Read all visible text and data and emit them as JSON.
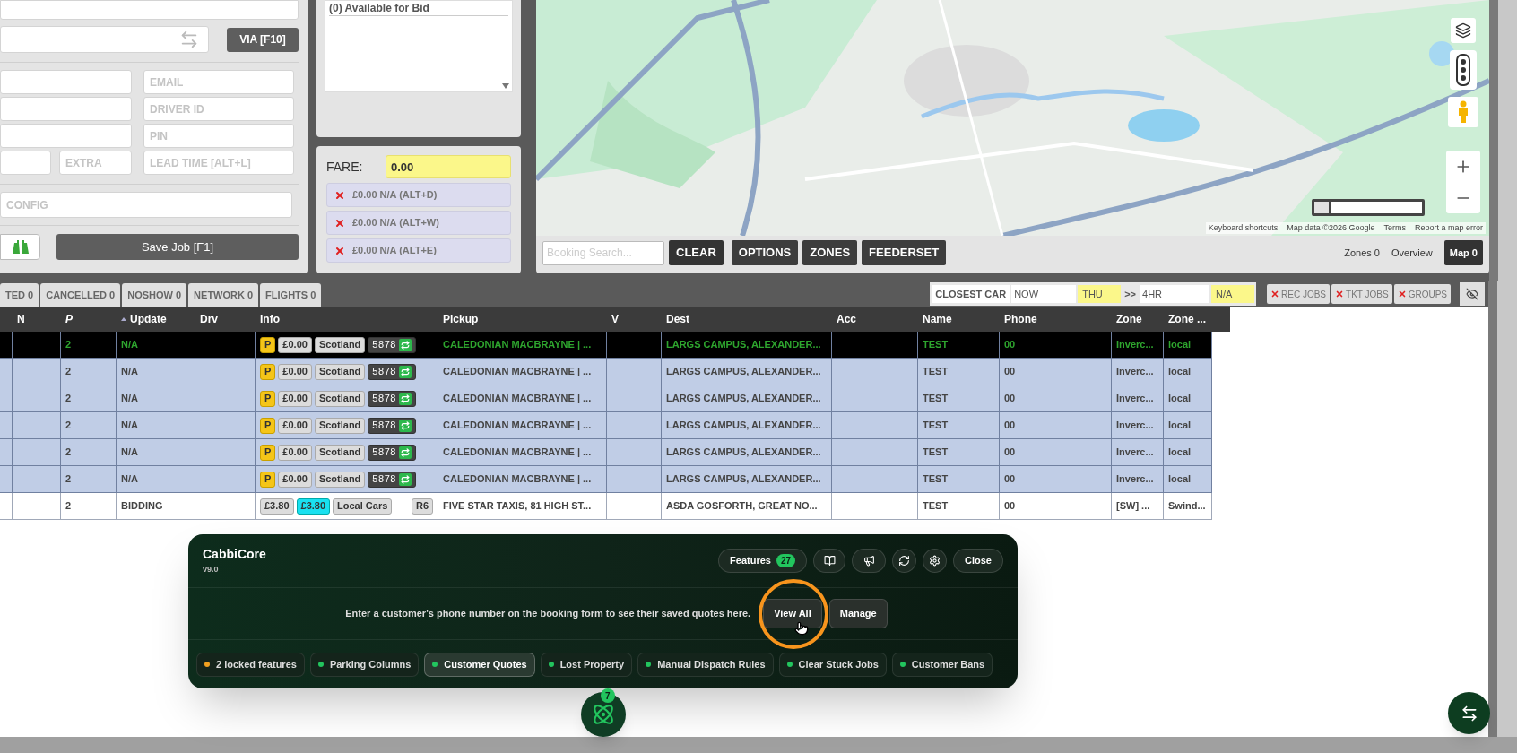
{
  "form": {
    "via_button": "VIA [F10]",
    "placeholders": [
      "EMAIL",
      "DRIVER ID",
      "PIN"
    ],
    "extra_placeholder": "EXTRA",
    "lead_time_placeholder": "LEAD TIME [ALT+L]",
    "config_placeholder": "CONFIG",
    "save_button": "Save Job [F1]"
  },
  "bid_list": {
    "items": [
      "(0) Available for Bid"
    ]
  },
  "fare": {
    "label": "FARE:",
    "value": "0.00",
    "extras": [
      "£0.00 N/A (ALT+D)",
      "£0.00 N/A (ALT+W)",
      "£0.00 N/A (ALT+E)"
    ]
  },
  "map": {
    "scale_slider": {
      "level": 0.15
    },
    "attribution": [
      "Keyboard shortcuts",
      "Map data ©2026 Google",
      "Terms",
      "Report a map error"
    ],
    "search": {
      "placeholder": "Booking Search..."
    },
    "buttons": [
      "CLEAR",
      "OPTIONS",
      "ZONES",
      "FEEDERSET"
    ],
    "status": [
      "Zones 0",
      "Overview"
    ],
    "map_button": "Map 0"
  },
  "tabs": [
    {
      "label": "TED 0"
    },
    {
      "label": "CANCELLED 0"
    },
    {
      "label": "NOSHOW 0"
    },
    {
      "label": "NETWORK 0"
    },
    {
      "label": "FLIGHTS 0"
    }
  ],
  "filters": {
    "closest_car": "CLOSEST CAR",
    "from": "NOW",
    "from_day": "THU",
    "separator": ">>",
    "to": "4HR",
    "to_day": "N/A",
    "toggles": [
      "REC JOBS",
      "TKT JOBS",
      "GROUPS"
    ]
  },
  "table": {
    "columns": [
      {
        "label": "N",
        "sorted": false
      },
      {
        "label": "P",
        "sorted": false
      },
      {
        "label": "Update",
        "sorted": true
      },
      {
        "label": "Drv",
        "sorted": false
      },
      {
        "label": "Info",
        "sorted": false
      },
      {
        "label": "Pickup",
        "sorted": false
      },
      {
        "label": "V",
        "sorted": false
      },
      {
        "label": "Dest",
        "sorted": false
      },
      {
        "label": "Acc",
        "sorted": false
      },
      {
        "label": "Name",
        "sorted": false
      },
      {
        "label": "Phone",
        "sorted": false
      },
      {
        "label": "Zone",
        "sorted": false
      },
      {
        "label": "Zone ...",
        "sorted": false
      }
    ],
    "rows": [
      {
        "selected": true,
        "shaded": true,
        "p": "2",
        "update": "N/A",
        "info": [
          {
            "kind": "p",
            "text": "P"
          },
          {
            "kind": "tag",
            "text": "£0.00"
          },
          {
            "kind": "tag",
            "text": "Scotland"
          },
          {
            "kind": "car",
            "text": "5878"
          }
        ],
        "pickup": "CALEDONIAN MACBRAYNE | ...",
        "dest": "LARGS CAMPUS, ALEXANDER...",
        "name": "TEST",
        "phone": "00",
        "zone": "Inverc...",
        "zone_2": "local"
      },
      {
        "selected": false,
        "shaded": true,
        "p": "2",
        "update": "N/A",
        "info": [
          {
            "kind": "p",
            "text": "P"
          },
          {
            "kind": "tag",
            "text": "£0.00"
          },
          {
            "kind": "tag",
            "text": "Scotland"
          },
          {
            "kind": "car",
            "text": "5878"
          }
        ],
        "pickup": "CALEDONIAN MACBRAYNE | ...",
        "dest": "LARGS CAMPUS, ALEXANDER...",
        "name": "TEST",
        "phone": "00",
        "zone": "Inverc...",
        "zone_2": "local"
      },
      {
        "selected": false,
        "shaded": true,
        "p": "2",
        "update": "N/A",
        "info": [
          {
            "kind": "p",
            "text": "P"
          },
          {
            "kind": "tag",
            "text": "£0.00"
          },
          {
            "kind": "tag",
            "text": "Scotland"
          },
          {
            "kind": "car",
            "text": "5878"
          }
        ],
        "pickup": "CALEDONIAN MACBRAYNE | ...",
        "dest": "LARGS CAMPUS, ALEXANDER...",
        "name": "TEST",
        "phone": "00",
        "zone": "Inverc...",
        "zone_2": "local"
      },
      {
        "selected": false,
        "shaded": true,
        "p": "2",
        "update": "N/A",
        "info": [
          {
            "kind": "p",
            "text": "P"
          },
          {
            "kind": "tag",
            "text": "£0.00"
          },
          {
            "kind": "tag",
            "text": "Scotland"
          },
          {
            "kind": "car",
            "text": "5878"
          }
        ],
        "pickup": "CALEDONIAN MACBRAYNE | ...",
        "dest": "LARGS CAMPUS, ALEXANDER...",
        "name": "TEST",
        "phone": "00",
        "zone": "Inverc...",
        "zone_2": "local"
      },
      {
        "selected": false,
        "shaded": true,
        "p": "2",
        "update": "N/A",
        "info": [
          {
            "kind": "p",
            "text": "P"
          },
          {
            "kind": "tag",
            "text": "£0.00"
          },
          {
            "kind": "tag",
            "text": "Scotland"
          },
          {
            "kind": "car",
            "text": "5878"
          }
        ],
        "pickup": "CALEDONIAN MACBRAYNE | ...",
        "dest": "LARGS CAMPUS, ALEXANDER...",
        "name": "TEST",
        "phone": "00",
        "zone": "Inverc...",
        "zone_2": "local"
      },
      {
        "selected": false,
        "shaded": true,
        "p": "2",
        "update": "N/A",
        "info": [
          {
            "kind": "p",
            "text": "P"
          },
          {
            "kind": "tag",
            "text": "£0.00"
          },
          {
            "kind": "tag",
            "text": "Scotland"
          },
          {
            "kind": "car",
            "text": "5878"
          }
        ],
        "pickup": "CALEDONIAN MACBRAYNE | ...",
        "dest": "LARGS CAMPUS, ALEXANDER...",
        "name": "TEST",
        "phone": "00",
        "zone": "Inverc...",
        "zone_2": "local"
      },
      {
        "selected": false,
        "shaded": false,
        "p": "2",
        "update": "BIDDING",
        "info": [
          {
            "kind": "tag",
            "text": "£3.80"
          },
          {
            "kind": "cyan",
            "text": "£3.80"
          },
          {
            "kind": "tag",
            "text": "Local Cars"
          },
          {
            "kind": "route",
            "text": "R6"
          }
        ],
        "pickup": "FIVE STAR TAXIS, 81 HIGH ST...",
        "dest": "ASDA GOSFORTH, GREAT NO...",
        "name": "TEST",
        "phone": "00",
        "zone": "[SW] ...",
        "zone_2": "Swind..."
      }
    ]
  },
  "panel": {
    "title": "CabbiCore",
    "version": "v9.0",
    "features_button": "Features",
    "features_count": "27",
    "close_button": "Close",
    "message": "Enter a customer's phone number on the booking form to see their saved quotes here.",
    "actions": [
      "View All",
      "Manage"
    ],
    "chips": [
      {
        "label": "2 locked features",
        "color": "#f0a020",
        "selected": false
      },
      {
        "label": "Parking Columns",
        "color": "#22c55e",
        "selected": false
      },
      {
        "label": "Customer Quotes",
        "color": "#22c55e",
        "selected": true
      },
      {
        "label": "Lost Property",
        "color": "#22c55e",
        "selected": false
      },
      {
        "label": "Manual Dispatch Rules",
        "color": "#22c55e",
        "selected": false
      },
      {
        "label": "Clear Stuck Jobs",
        "color": "#22c55e",
        "selected": false
      },
      {
        "label": "Customer Bans",
        "color": "#22c55e",
        "selected": false
      }
    ]
  },
  "launcher_badge": "7"
}
